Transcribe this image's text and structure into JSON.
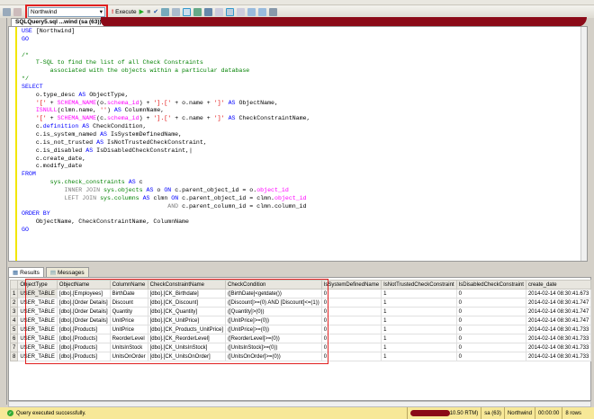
{
  "toolbar": {
    "database": "Northwind",
    "execute_label": "Execute"
  },
  "document_tab": "SQLQuery5.sql ...wind (sa (63))*",
  "code": [
    [
      [
        "USE",
        "kw"
      ],
      [
        " [Northwind]",
        ""
      ]
    ],
    [
      [
        "GO",
        "kw"
      ]
    ],
    [],
    [
      [
        "/*",
        "cm"
      ]
    ],
    [
      [
        "    T-SQL to find the list of all Check Constraints",
        "cm"
      ]
    ],
    [
      [
        "        associated with the objects within a particular database",
        "cm"
      ]
    ],
    [
      [
        "*/",
        "cm"
      ]
    ],
    [
      [
        "SELECT",
        "kw"
      ]
    ],
    [
      [
        "    o.type_desc ",
        ""
      ],
      [
        "AS",
        "kw"
      ],
      [
        " ObjectType,",
        ""
      ]
    ],
    [
      [
        "    ",
        ""
      ],
      [
        "'['",
        "st"
      ],
      [
        " + ",
        ""
      ],
      [
        "SCHEMA_NAME",
        "fn"
      ],
      [
        "(o.",
        ""
      ],
      [
        "schema_id",
        "fn"
      ],
      [
        ") + ",
        ""
      ],
      [
        "'].['",
        "st"
      ],
      [
        " + o.name + ",
        ""
      ],
      [
        "']'",
        "st"
      ],
      [
        " ",
        ""
      ],
      [
        "AS",
        "kw"
      ],
      [
        " ObjectName,",
        ""
      ]
    ],
    [
      [
        "    ",
        ""
      ],
      [
        "ISNULL",
        "fn"
      ],
      [
        "(clmn.name, ",
        ""
      ],
      [
        "''",
        "st"
      ],
      [
        ") ",
        ""
      ],
      [
        "AS",
        "kw"
      ],
      [
        " ColumnName,",
        ""
      ]
    ],
    [
      [
        "    ",
        ""
      ],
      [
        "'['",
        "st"
      ],
      [
        " + ",
        ""
      ],
      [
        "SCHEMA_NAME",
        "fn"
      ],
      [
        "(c.",
        ""
      ],
      [
        "schema_id",
        "fn"
      ],
      [
        ") + ",
        ""
      ],
      [
        "'].['",
        "st"
      ],
      [
        " + c.name + ",
        ""
      ],
      [
        "']'",
        "st"
      ],
      [
        " ",
        ""
      ],
      [
        "AS",
        "kw"
      ],
      [
        " CheckConstraintName,",
        ""
      ]
    ],
    [
      [
        "    c.",
        ""
      ],
      [
        "definition",
        "kw"
      ],
      [
        " ",
        ""
      ],
      [
        "AS",
        "kw"
      ],
      [
        " CheckCondition,",
        ""
      ]
    ],
    [
      [
        "    c.is_system_named ",
        ""
      ],
      [
        "AS",
        "kw"
      ],
      [
        " IsSystemDefinedName,",
        ""
      ]
    ],
    [
      [
        "    c.is_not_trusted ",
        ""
      ],
      [
        "AS",
        "kw"
      ],
      [
        " IsNotTrustedCheckConstraint,",
        ""
      ]
    ],
    [
      [
        "    c.is_disabled ",
        ""
      ],
      [
        "AS",
        "kw"
      ],
      [
        " IsDisabledCheckConstraint,|",
        ""
      ]
    ],
    [
      [
        "    c.create_date,",
        ""
      ]
    ],
    [
      [
        "    c.modify_date",
        ""
      ]
    ],
    [
      [
        "FROM",
        "kw"
      ]
    ],
    [
      [
        "        ",
        ""
      ],
      [
        "sys.check_constraints",
        "sy"
      ],
      [
        " ",
        ""
      ],
      [
        "AS",
        "kw"
      ],
      [
        " c",
        ""
      ]
    ],
    [
      [
        "            ",
        ""
      ],
      [
        "INNER JOIN",
        "gr"
      ],
      [
        " ",
        ""
      ],
      [
        "sys.objects",
        "sy"
      ],
      [
        " ",
        ""
      ],
      [
        "AS",
        "kw"
      ],
      [
        " o ",
        ""
      ],
      [
        "ON",
        "kw"
      ],
      [
        " c.parent_object_id = o.",
        ""
      ],
      [
        "object_id",
        "fn"
      ]
    ],
    [
      [
        "            ",
        ""
      ],
      [
        "LEFT JOIN",
        "gr"
      ],
      [
        " ",
        ""
      ],
      [
        "sys.columns",
        "sy"
      ],
      [
        " ",
        ""
      ],
      [
        "AS",
        "kw"
      ],
      [
        " clmn ",
        ""
      ],
      [
        "ON",
        "kw"
      ],
      [
        " c.parent_object_id = clmn.",
        ""
      ],
      [
        "object_id",
        "fn"
      ]
    ],
    [
      [
        "                                         ",
        ""
      ],
      [
        "AND",
        "gr"
      ],
      [
        " c.parent_column_id = clmn.column_id",
        ""
      ]
    ],
    [
      [
        "ORDER BY",
        "kw"
      ]
    ],
    [
      [
        "    ObjectName, CheckConstraintName, ColumnName",
        ""
      ]
    ],
    [
      [
        "GO",
        "kw"
      ]
    ]
  ],
  "results_tabs": [
    "Results",
    "Messages"
  ],
  "grid": {
    "columns": [
      "ObjectType",
      "ObjectName",
      "ColumnName",
      "CheckConstraintName",
      "CheckCondition",
      "IsSystemDefinedName",
      "IsNotTrustedCheckConstraint",
      "IsDisabledCheckConstraint",
      "create_date"
    ],
    "rows": [
      [
        "USER_TABLE",
        "[dbo].[Employees]",
        "BirthDate",
        "[dbo].[CK_Birthdate]",
        "([BirthDate]<getdate())",
        "0",
        "1",
        "0",
        "2014-02-14 08:30:41.673"
      ],
      [
        "USER_TABLE",
        "[dbo].[Order Details]",
        "Discount",
        "[dbo].[CK_Discount]",
        "([Discount]>=(0) AND [Discount]<=(1))",
        "0",
        "1",
        "0",
        "2014-02-14 08:30:41.747"
      ],
      [
        "USER_TABLE",
        "[dbo].[Order Details]",
        "Quantity",
        "[dbo].[CK_Quantity]",
        "([Quantity]>(0))",
        "0",
        "1",
        "0",
        "2014-02-14 08:30:41.747"
      ],
      [
        "USER_TABLE",
        "[dbo].[Order Details]",
        "UnitPrice",
        "[dbo].[CK_UnitPrice]",
        "([UnitPrice]>=(0))",
        "0",
        "1",
        "0",
        "2014-02-14 08:30:41.747"
      ],
      [
        "USER_TABLE",
        "[dbo].[Products]",
        "UnitPrice",
        "[dbo].[CK_Products_UnitPrice]",
        "([UnitPrice]>=(0))",
        "0",
        "1",
        "0",
        "2014-02-14 08:30:41.733"
      ],
      [
        "USER_TABLE",
        "[dbo].[Products]",
        "ReorderLevel",
        "[dbo].[CK_ReorderLevel]",
        "([ReorderLevel]>=(0))",
        "0",
        "1",
        "0",
        "2014-02-14 08:30:41.733"
      ],
      [
        "USER_TABLE",
        "[dbo].[Products]",
        "UnitsInStock",
        "[dbo].[CK_UnitsInStock]",
        "([UnitsInStock]>=(0))",
        "0",
        "1",
        "0",
        "2014-02-14 08:30:41.733"
      ],
      [
        "USER_TABLE",
        "[dbo].[Products]",
        "UnitsOnOrder",
        "[dbo].[CK_UnitsOnOrder]",
        "([UnitsOnOrder]>=(0))",
        "0",
        "1",
        "0",
        "2014-02-14 08:30:41.733"
      ]
    ]
  },
  "status": {
    "message": "Query executed successfully.",
    "server": "10.50 RTM)",
    "user": "sa (63)",
    "database": "Northwind",
    "elapsed": "00:00:00",
    "rows": "8 rows"
  },
  "colors": {
    "highlight": "#e02020",
    "status_bg": "#f7e898"
  }
}
